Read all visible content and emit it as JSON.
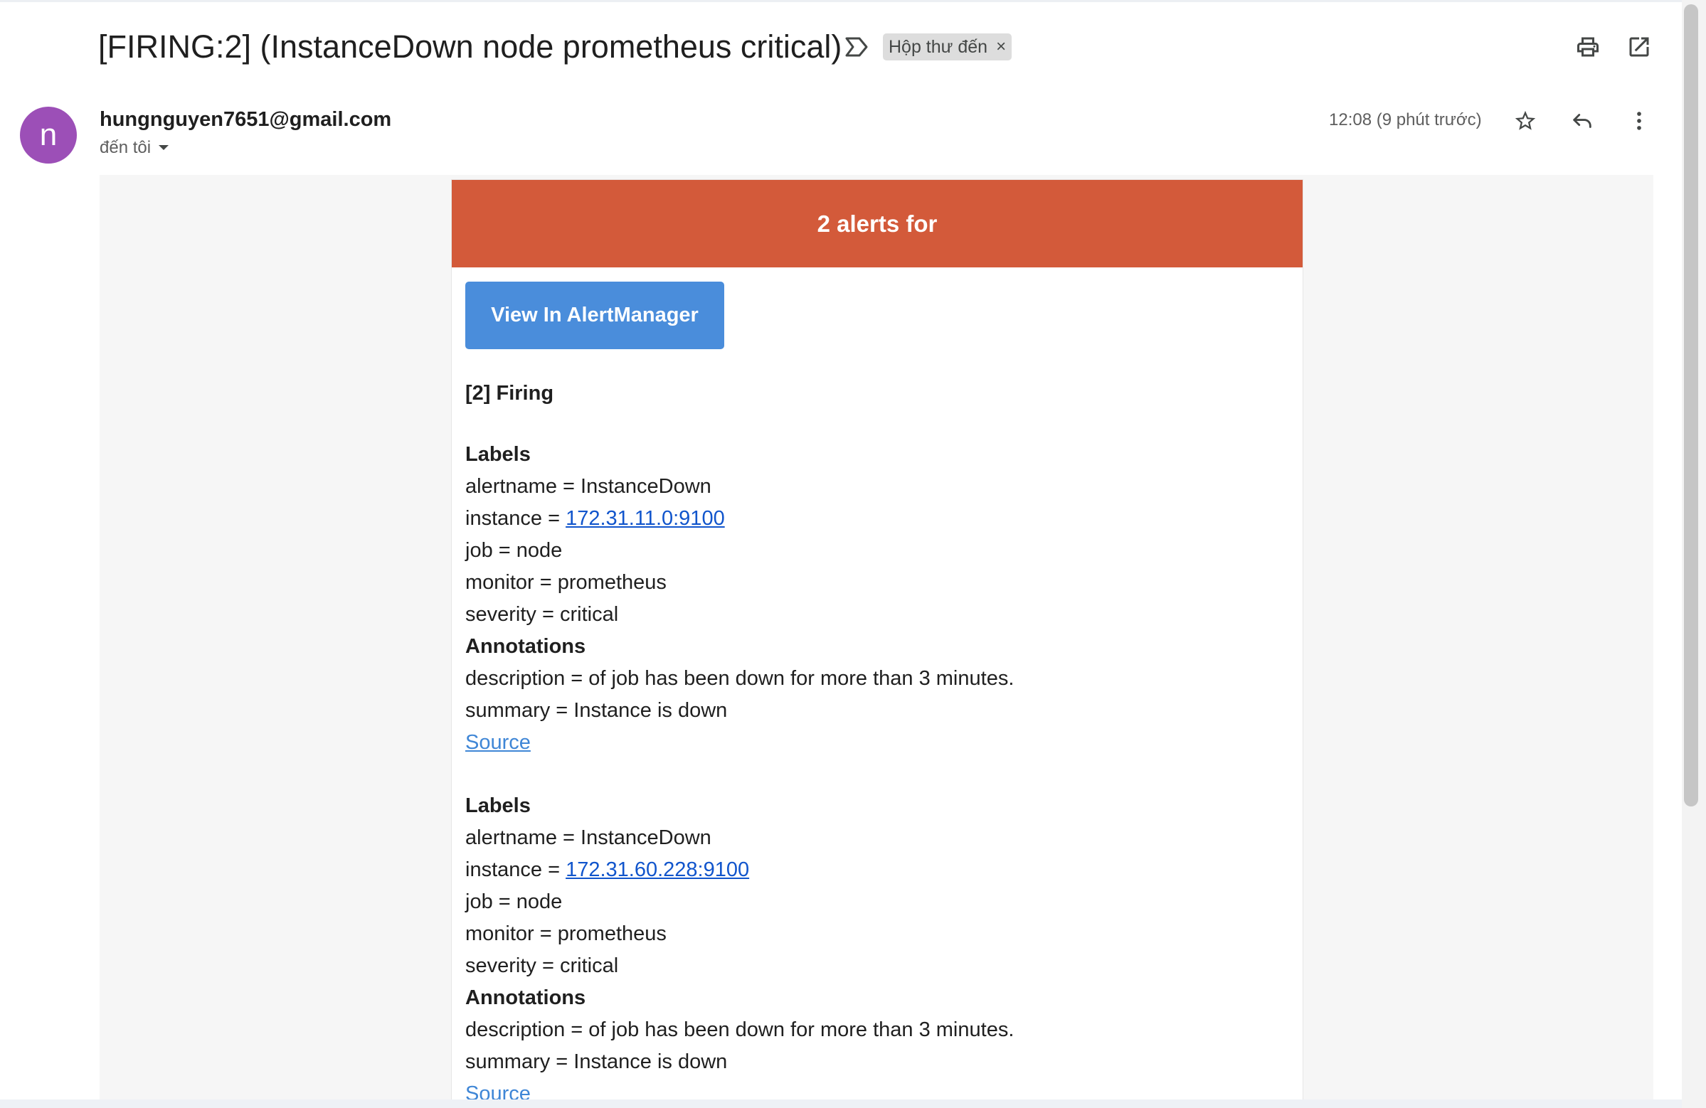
{
  "email": {
    "subject": "[FIRING:2] (InstanceDown node prometheus critical)",
    "label_chip": "Hộp thư đến",
    "label_chip_close": "×",
    "sender_initial": "n",
    "sender": "hungnguyen7651@gmail.com",
    "recipient": "đến tôi",
    "timestamp": "12:08 (9 phút trước)"
  },
  "icons": {
    "important": "important-marker-icon",
    "print": "print-icon",
    "open_new_window": "open-in-new-window-icon",
    "star": "star-icon",
    "reply": "reply-icon",
    "more": "more-vert-icon",
    "dropdown": "chevron-down-icon"
  },
  "colors": {
    "header_banner": "#d35a3a",
    "button": "#4a8ddb",
    "avatar": "#9c4fb7",
    "link": "#1155cc",
    "source_link": "#3f86d6"
  },
  "message": {
    "banner": "2 alerts for",
    "button": "View In AlertManager",
    "firing_heading": "[2] Firing",
    "alerts": [
      {
        "labels_heading": "Labels",
        "alertname": "alertname = InstanceDown",
        "instance_prefix": "instance = ",
        "instance_link": "172.31.11.0:9100",
        "job": "job = node",
        "monitor": "monitor = prometheus",
        "severity": "severity = critical",
        "annotations_heading": "Annotations",
        "description": "description = of job has been down for more than 3 minutes.",
        "summary": "summary = Instance is down",
        "source": "Source"
      },
      {
        "labels_heading": "Labels",
        "alertname": "alertname = InstanceDown",
        "instance_prefix": "instance = ",
        "instance_link": "172.31.60.228:9100",
        "job": "job = node",
        "monitor": "monitor = prometheus",
        "severity": "severity = critical",
        "annotations_heading": "Annotations",
        "description": "description = of job has been down for more than 3 minutes.",
        "summary": "summary = Instance is down",
        "source": "Source"
      }
    ]
  }
}
